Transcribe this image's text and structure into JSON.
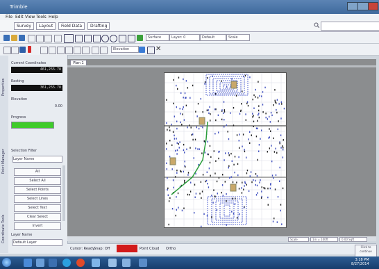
{
  "window": {
    "title": "Trimble"
  },
  "menu": {
    "items": [
      "File",
      "Edit",
      "View",
      "Tools",
      "Help"
    ]
  },
  "tabs": [
    {
      "label": "Survey"
    },
    {
      "label": "Layout"
    },
    {
      "label": "Field Data"
    },
    {
      "label": "Drafting"
    }
  ],
  "search": {
    "value": ""
  },
  "toolbar2": {
    "fields": [
      "Surface",
      "Layer: 0",
      "Default",
      "Scale"
    ]
  },
  "toolbar3": {
    "field": "Elevation"
  },
  "left_panel": {
    "vertical_tabs": [
      "Properties",
      "Point Manager",
      "Coordinate Tools"
    ],
    "coordinates_label": "Current Coordinates",
    "northing": "461,255.78",
    "easting_label": "Easting",
    "easting": "361,255.78",
    "elevation_label": "Elevation",
    "elevation_value": "0.00",
    "progress_label": "Progress",
    "progress_percent": 100,
    "project_label": "Selection Filter",
    "project_value": "Layer Name",
    "buttons": [
      "All",
      "Select All",
      "Select Points",
      "Select Lines",
      "Select Text",
      "Clear Select",
      "Invert"
    ],
    "bottom_label": "Layer Name",
    "bottom_value": "Default Layer"
  },
  "canvas": {
    "doc_tab": "Plan 1",
    "scroll_fields": [
      "Scale",
      "1in = 100ft",
      "0.00 Sqft"
    ]
  },
  "status": {
    "items": [
      "Cursor: Ready",
      "Snap: Off",
      "Point Cloud",
      "Ortho"
    ],
    "side_message": "Click to continue"
  },
  "taskbar": {
    "clock_time": "3:18 PM",
    "clock_date": "8/27/2014"
  }
}
